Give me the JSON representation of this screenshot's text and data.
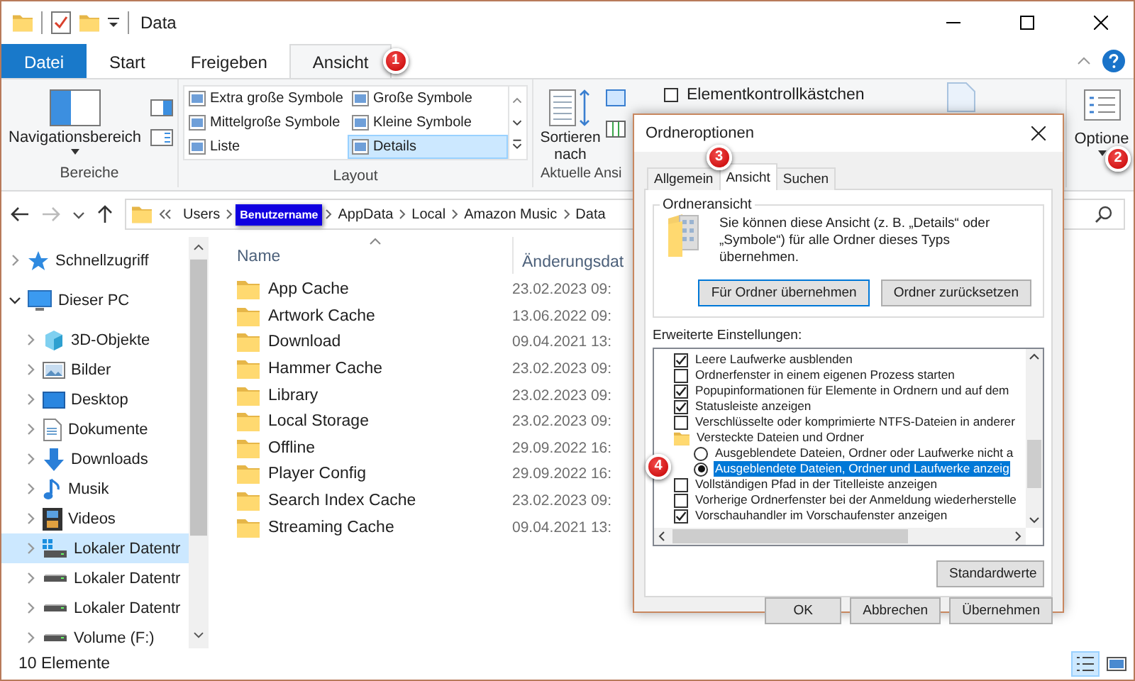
{
  "title_bar": {
    "title": "Data"
  },
  "ribbon_tabs": [
    {
      "label": "Datei",
      "kind": "file",
      "selected": false
    },
    {
      "label": "Start",
      "kind": "tab",
      "selected": false
    },
    {
      "label": "Freigeben",
      "kind": "tab",
      "selected": false
    },
    {
      "label": "Ansicht",
      "kind": "tab",
      "selected": true,
      "badge": "1"
    }
  ],
  "ribbon": {
    "panes": {
      "group": "Bereiche",
      "button": "Navigationsbereich"
    },
    "layout": {
      "group": "Layout",
      "items": [
        {
          "label": "Extra große Symbole",
          "selected": false
        },
        {
          "label": "Große Symbole",
          "selected": false
        },
        {
          "label": "Mittelgroße Symbole",
          "selected": false
        },
        {
          "label": "Kleine Symbole",
          "selected": false
        },
        {
          "label": "Liste",
          "selected": false
        },
        {
          "label": "Details",
          "selected": true
        }
      ]
    },
    "current_view": {
      "group": "Aktuelle Ansi",
      "sort_button": "Sortieren nach"
    },
    "show_hide": {
      "checkboxes": [
        {
          "label": "Elementkontrollkästchen",
          "checked": false
        }
      ]
    },
    "options": {
      "button": "Optione",
      "badge": "2"
    }
  },
  "address_bar": {
    "breadcrumbs": [
      {
        "label": "Users",
        "highlighted": false
      },
      {
        "label": "Benutzername",
        "highlighted": true
      },
      {
        "label": "AppData",
        "highlighted": false
      },
      {
        "label": "Local",
        "highlighted": false
      },
      {
        "label": "Amazon Music",
        "highlighted": false
      },
      {
        "label": "Data",
        "highlighted": false
      }
    ]
  },
  "nav_pane": {
    "items": [
      {
        "label": "Schnellzugriff",
        "kind": "quick-access",
        "expanded": false,
        "selected": false
      },
      {
        "label": "Dieser PC",
        "kind": "pc",
        "expanded": true,
        "selected": false,
        "children": [
          {
            "label": "3D-Objekte",
            "kind": "cube",
            "expanded": false,
            "selected": false
          },
          {
            "label": "Bilder",
            "kind": "pictures",
            "expanded": false,
            "selected": false
          },
          {
            "label": "Desktop",
            "kind": "desktop",
            "expanded": false,
            "selected": false
          },
          {
            "label": "Dokumente",
            "kind": "documents",
            "expanded": false,
            "selected": false
          },
          {
            "label": "Downloads",
            "kind": "download",
            "expanded": false,
            "selected": false
          },
          {
            "label": "Musik",
            "kind": "music",
            "expanded": false,
            "selected": false
          },
          {
            "label": "Videos",
            "kind": "video",
            "expanded": false,
            "selected": false
          },
          {
            "label": "Lokaler Datentr",
            "kind": "drive-system",
            "expanded": false,
            "selected": true
          },
          {
            "label": "Lokaler Datentr",
            "kind": "drive",
            "expanded": false,
            "selected": false
          },
          {
            "label": "Lokaler Datentr",
            "kind": "drive",
            "expanded": false,
            "selected": false
          },
          {
            "label": "Volume (F:)",
            "kind": "drive",
            "expanded": false,
            "selected": false
          }
        ]
      }
    ]
  },
  "file_list": {
    "columns": [
      "Name",
      "Änderungsdat"
    ],
    "rows": [
      {
        "name": "App Cache",
        "modified": "23.02.2023 09:"
      },
      {
        "name": "Artwork Cache",
        "modified": "13.06.2022 09:"
      },
      {
        "name": "Download",
        "modified": "09.04.2021 13:"
      },
      {
        "name": "Hammer Cache",
        "modified": "23.02.2023 09:"
      },
      {
        "name": "Library",
        "modified": "23.02.2023 09:"
      },
      {
        "name": "Local Storage",
        "modified": "23.02.2023 09:"
      },
      {
        "name": "Offline",
        "modified": "29.09.2022 16:"
      },
      {
        "name": "Player Config",
        "modified": "29.09.2022 16:"
      },
      {
        "name": "Search Index Cache",
        "modified": "23.02.2023 09:"
      },
      {
        "name": "Streaming Cache",
        "modified": "09.04.2021 13:"
      }
    ]
  },
  "status_bar": {
    "count": "10 Elemente",
    "views": [
      {
        "kind": "details",
        "selected": true
      },
      {
        "kind": "tiles",
        "selected": false
      }
    ]
  },
  "dialog": {
    "title": "Ordneroptionen",
    "tabs": [
      {
        "label": "Allgemein",
        "selected": false
      },
      {
        "label": "Ansicht",
        "selected": true,
        "badge": "3"
      },
      {
        "label": "Suchen",
        "selected": false
      }
    ],
    "folder_view": {
      "title": "Ordneransicht",
      "text": "Sie können diese Ansicht (z. B. „Details“ oder „Symbole“) für alle Ordner dieses Typs übernehmen.",
      "buttons": [
        "Für Ordner übernehmen",
        "Ordner zurücksetzen"
      ]
    },
    "advanced_label": "Erweiterte Einstellungen:",
    "settings": [
      {
        "kind": "checkbox",
        "label": "Leere Laufwerke ausblenden",
        "checked": true,
        "selected": false
      },
      {
        "kind": "checkbox",
        "label": "Ordnerfenster in einem eigenen Prozess starten",
        "checked": false,
        "selected": false
      },
      {
        "kind": "checkbox",
        "label": "Popupinformationen für Elemente in Ordnern und auf dem",
        "checked": true,
        "selected": false
      },
      {
        "kind": "checkbox",
        "label": "Statusleiste anzeigen",
        "checked": true,
        "selected": false
      },
      {
        "kind": "checkbox",
        "label": "Verschlüsselte oder komprimierte NTFS-Dateien in anderer",
        "checked": false,
        "selected": false
      },
      {
        "kind": "folder",
        "label": "Versteckte Dateien und Ordner",
        "selected": false
      },
      {
        "kind": "radio",
        "label": "Ausgeblendete Dateien, Ordner oder Laufwerke nicht a",
        "checked": false,
        "selected": false
      },
      {
        "kind": "radio",
        "label": "Ausgeblendete Dateien, Ordner und Laufwerke anzeig",
        "checked": true,
        "selected": true,
        "badge": "4"
      },
      {
        "kind": "checkbox",
        "label": "Vollständigen Pfad in der Titelleiste anzeigen",
        "checked": false,
        "selected": false
      },
      {
        "kind": "checkbox",
        "label": "Vorherige Ordnerfenster bei der Anmeldung wiederherstelle",
        "checked": false,
        "selected": false
      },
      {
        "kind": "checkbox",
        "label": "Vorschauhandler im Vorschaufenster anzeigen",
        "checked": true,
        "selected": false
      }
    ],
    "defaults_button": "Standardwerte",
    "buttons": [
      "OK",
      "Abbrechen",
      "Übernehmen"
    ]
  }
}
